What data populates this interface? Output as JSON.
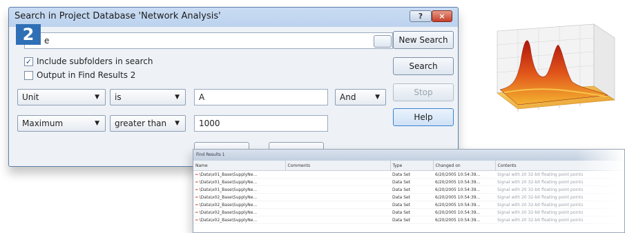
{
  "dialog": {
    "title": "Search in Project Database 'Network Analysis'",
    "help_icon": "?",
    "close_icon": "×",
    "step_badge": "2",
    "name_field_value": "e",
    "include_subfolders_label": "Include subfolders in search",
    "include_subfolders_checked": true,
    "output_find_results_label": "Output in Find Results 2",
    "output_find_results_checked": false,
    "criteria": [
      {
        "field": "Unit",
        "operator": "is",
        "value": "A",
        "logic": "And"
      },
      {
        "field": "Maximum",
        "operator": "greater than",
        "value": "1000"
      }
    ],
    "buttons": {
      "new_search": "New Search",
      "search": "Search",
      "stop": "Stop",
      "help": "Help"
    },
    "check_mark": "✓",
    "dropdown_arrow": "▼"
  },
  "results": {
    "title": "Find Results 1",
    "columns": [
      "Name",
      "Comments",
      "Type",
      "Changed on",
      "Contents"
    ],
    "rows": [
      {
        "name": "\\Data\\x01_Base\\SupplyNe...",
        "comments": "",
        "type": "Data Set",
        "changed": "6/20/2005 10:54:39...",
        "contents": "Signal with 20 32-bit floating point points"
      },
      {
        "name": "\\Data\\x01_Base\\SupplyNe...",
        "comments": "",
        "type": "Data Set",
        "changed": "6/20/2005 10:54:39...",
        "contents": "Signal with 20 32-bit floating point points"
      },
      {
        "name": "\\Data\\x01_Base\\SupplyNe...",
        "comments": "",
        "type": "Data Set",
        "changed": "6/20/2005 10:54:39...",
        "contents": "Signal with 20 32-bit floating point points"
      },
      {
        "name": "\\Data\\x02_Base\\SupplyNe...",
        "comments": "",
        "type": "Data Set",
        "changed": "6/20/2005 10:54:39...",
        "contents": "Signal with 20 32-bit floating point points"
      },
      {
        "name": "\\Data\\x02_Base\\SupplyNe...",
        "comments": "",
        "type": "Data Set",
        "changed": "6/20/2005 10:54:39...",
        "contents": "Signal with 20 32-bit floating point points"
      },
      {
        "name": "\\Data\\x02_Base\\SupplyNe...",
        "comments": "",
        "type": "Data Set",
        "changed": "6/20/2005 10:54:39...",
        "contents": "Signal with 20 32-bit floating point points"
      },
      {
        "name": "\\Data\\x02_Base\\SupplyNe...",
        "comments": "",
        "type": "Data Set",
        "changed": "6/20/2005 10:54:39...",
        "contents": "Signal with 20 32-bit floating point points"
      }
    ],
    "signal_icon": "signal-icon"
  },
  "colors": {
    "accent": "#2f6fb6",
    "title_bar": "#c9dcf2",
    "close_button": "#c4402a",
    "signal_icon": "#c53a2b"
  }
}
